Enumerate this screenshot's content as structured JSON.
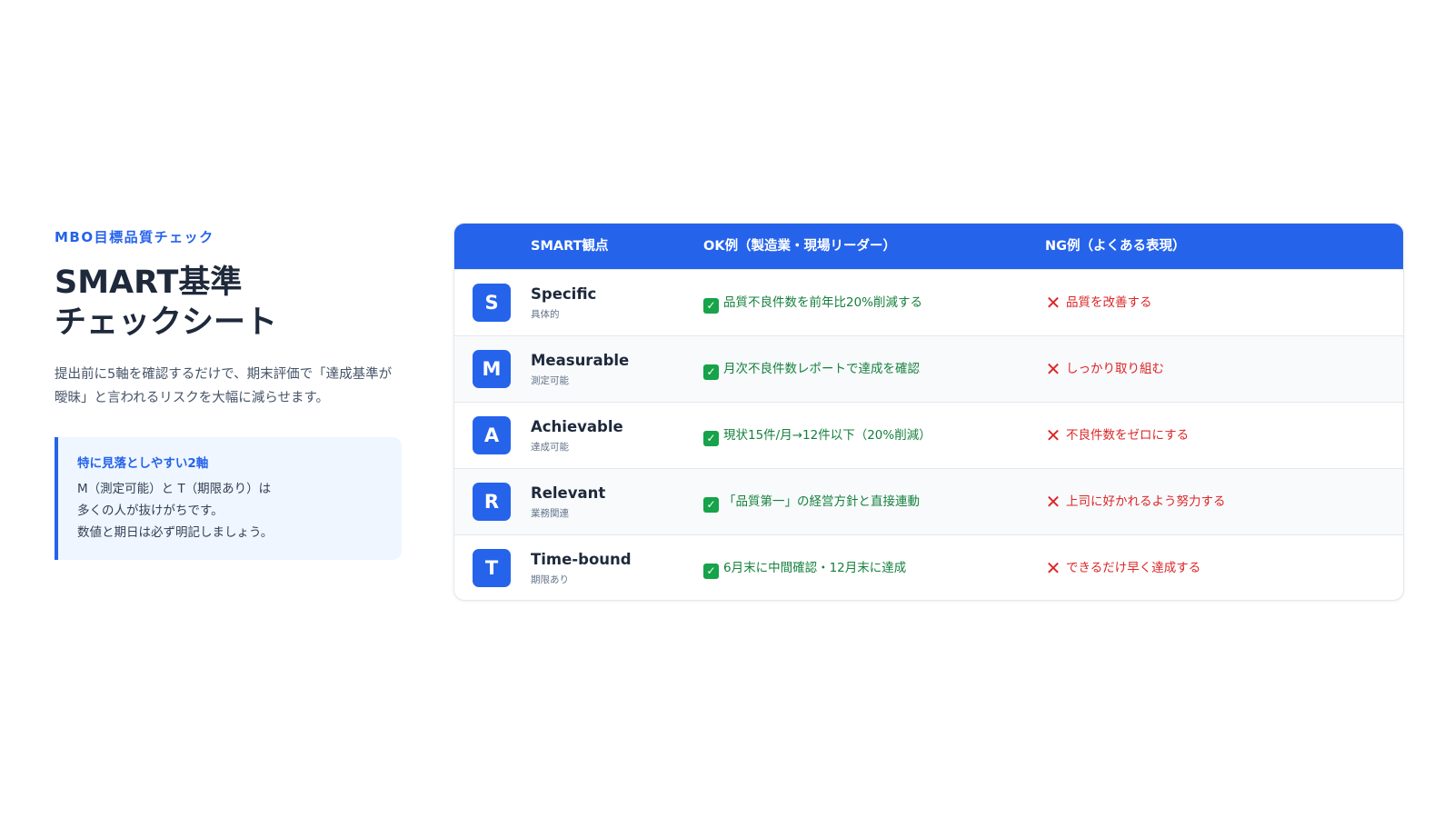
{
  "header": {
    "eyebrow": "MBO目標品質チェック",
    "title_line1": "SMART基準",
    "title_line2": "チェックシート",
    "description": "提出前に5軸を確認するだけで、期末評価で「達成基準が曖昧」と言われるリスクを大幅に減らせます。"
  },
  "callout": {
    "title": "特に見落としやすい2軸",
    "lines": [
      "M（測定可能）と T（期限あり）は",
      "多くの人が抜けがちです。",
      "数値と期日は必ず明記しましょう。"
    ]
  },
  "table": {
    "headers": {
      "smart": "SMART観点",
      "ok": "OK例（製造業・現場リーダー）",
      "ng": "NG例（よくある表現）"
    },
    "rows": [
      {
        "letter": "S",
        "name": "Specific",
        "sub": "具体的",
        "ok": "品質不良件数を前年比20%削減する",
        "ng": "品質を改善する"
      },
      {
        "letter": "M",
        "name": "Measurable",
        "sub": "測定可能",
        "ok": "月次不良件数レポートで達成を確認",
        "ng": "しっかり取り組む"
      },
      {
        "letter": "A",
        "name": "Achievable",
        "sub": "達成可能",
        "ok": "現状15件/月→12件以下（20%削減）",
        "ng": "不良件数をゼロにする"
      },
      {
        "letter": "R",
        "name": "Relevant",
        "sub": "業務関連",
        "ok": "「品質第一」の経営方針と直接連動",
        "ng": "上司に好かれるよう努力する"
      },
      {
        "letter": "T",
        "name": "Time-bound",
        "sub": "期限あり",
        "ok": "6月末に中間確認・12月末に達成",
        "ng": "できるだけ早く達成する"
      }
    ]
  },
  "icons": {
    "ok": "check-mark-icon",
    "ng": "cross-mark-icon"
  },
  "colors": {
    "accent": "#2563eb",
    "ok": "#15803d",
    "ng": "#dc2626"
  }
}
